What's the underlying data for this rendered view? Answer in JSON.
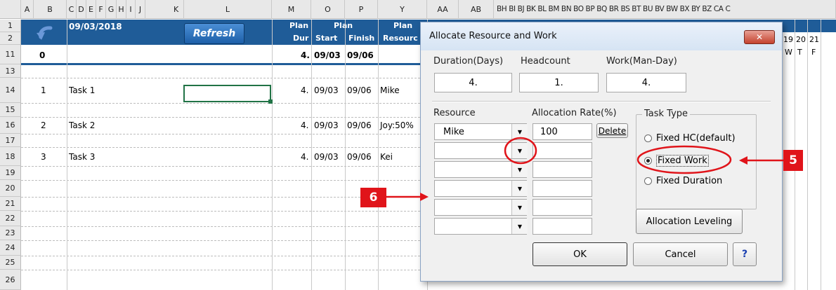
{
  "sheet": {
    "columns": [
      "A",
      "B",
      "C",
      "D",
      "E",
      "F",
      "G",
      "H",
      "I",
      "J",
      "K",
      "L",
      "M",
      "O",
      "P",
      "Y",
      "AA",
      "AB",
      "BH BI BJ BK BL BM BN BO BP BQ BR BS BT BU BV BW BX BY BZ CA C"
    ],
    "rows": [
      "1",
      "2",
      "11",
      "13",
      "14",
      "15",
      "16",
      "17",
      "18",
      "19",
      "20",
      "21",
      "22",
      "23",
      "24",
      "25",
      "26"
    ],
    "date": "09/03/2018",
    "refresh_label": "Refresh",
    "hdr_plan_dur_1": "Plan",
    "hdr_plan_dur_2": "Dur",
    "hdr_plan": "Plan",
    "hdr_start": "Start",
    "hdr_finish": "Finish",
    "hdr_plan_res_1": "Plan",
    "hdr_plan_res_2": "Resourc",
    "cal_days": [
      "19",
      "20",
      "21"
    ],
    "cal_weekdays": [
      "W",
      "T",
      "F"
    ],
    "summary": {
      "id": "0",
      "dur": "4.",
      "start": "09/03",
      "finish": "09/06"
    },
    "tasks": [
      {
        "id": "1",
        "name": "Task 1",
        "dur": "4.",
        "start": "09/03",
        "finish": "09/06",
        "resource": "Mike"
      },
      {
        "id": "2",
        "name": "Task 2",
        "dur": "4.",
        "start": "09/03",
        "finish": "09/06",
        "resource": "Joy:50%"
      },
      {
        "id": "3",
        "name": "Task 3",
        "dur": "4.",
        "start": "09/03",
        "finish": "09/06",
        "resource": "Kei"
      }
    ]
  },
  "dialog": {
    "title": "Allocate Resource and Work",
    "duration_label": "Duration(Days)",
    "headcount_label": "Headcount",
    "work_label": "Work(Man-Day)",
    "duration_value": "4.",
    "headcount_value": "1.",
    "work_value": "4.",
    "resource_label": "Resource",
    "allocation_label": "Allocation Rate(%)",
    "resources": [
      "Mike",
      "",
      "",
      "",
      "",
      ""
    ],
    "allocations": [
      "100",
      "",
      "",
      "",
      "",
      ""
    ],
    "delete_label": "Delete",
    "task_type_label": "Task Type",
    "task_types": [
      "Fixed HC(default)",
      "Fixed Work",
      "Fixed Duration"
    ],
    "selected_task_type": "Fixed Work",
    "leveling_label": "Allocation Leveling",
    "ok_label": "OK",
    "cancel_label": "Cancel",
    "help_label": "?"
  },
  "callouts": {
    "five": "5",
    "six": "6"
  },
  "colors": {
    "header_blue": "#1f5c98",
    "callout_red": "#e0141a"
  }
}
